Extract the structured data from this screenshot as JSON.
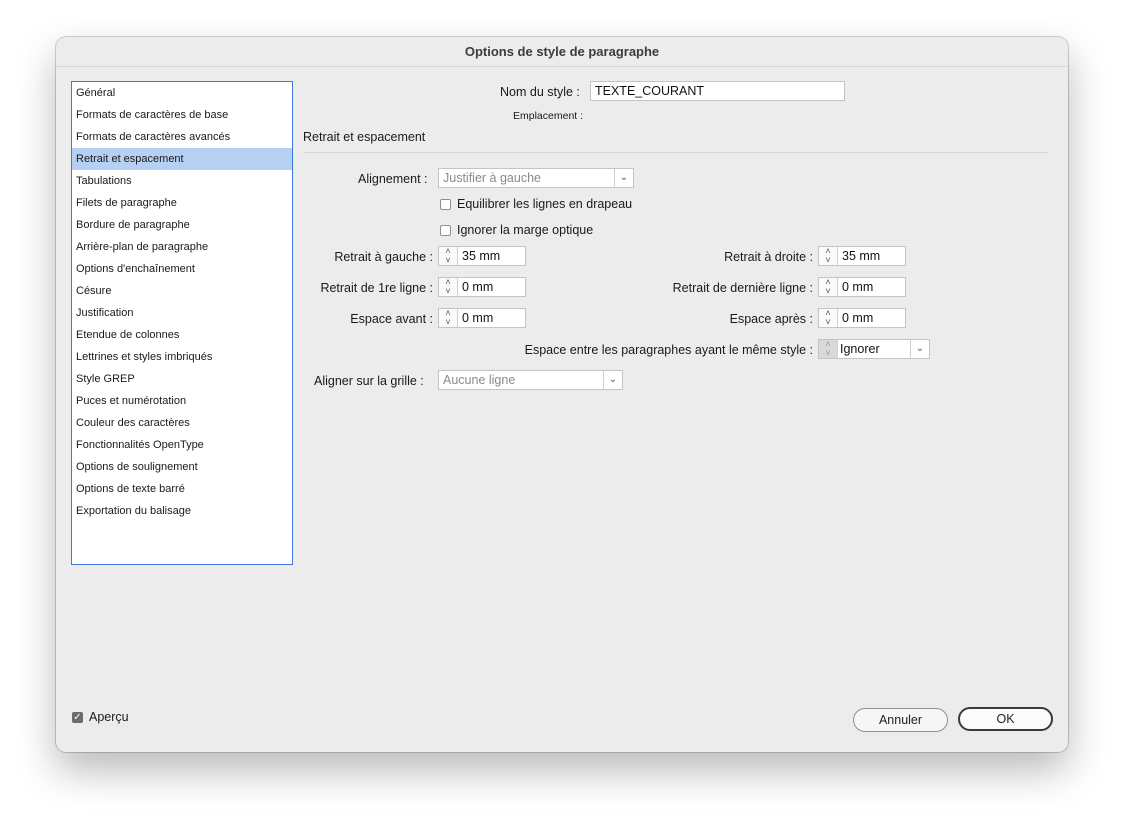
{
  "window": {
    "title": "Options de style de paragraphe"
  },
  "sidebar": {
    "items": [
      {
        "label": "Général",
        "selected": false
      },
      {
        "label": "Formats de caractères de base",
        "selected": false
      },
      {
        "label": "Formats de caractères avancés",
        "selected": false
      },
      {
        "label": "Retrait et espacement",
        "selected": true
      },
      {
        "label": "Tabulations",
        "selected": false
      },
      {
        "label": "Filets de paragraphe",
        "selected": false
      },
      {
        "label": "Bordure de paragraphe",
        "selected": false
      },
      {
        "label": "Arrière-plan de paragraphe",
        "selected": false
      },
      {
        "label": "Options d'enchaînement",
        "selected": false
      },
      {
        "label": "Césure",
        "selected": false
      },
      {
        "label": "Justification",
        "selected": false
      },
      {
        "label": "Etendue de colonnes",
        "selected": false
      },
      {
        "label": "Lettrines et styles imbriqués",
        "selected": false
      },
      {
        "label": "Style GREP",
        "selected": false
      },
      {
        "label": "Puces et numérotation",
        "selected": false
      },
      {
        "label": "Couleur des caractères",
        "selected": false
      },
      {
        "label": "Fonctionnalités OpenType",
        "selected": false
      },
      {
        "label": "Options de soulignement",
        "selected": false
      },
      {
        "label": "Options de texte barré",
        "selected": false
      },
      {
        "label": "Exportation du balisage",
        "selected": false
      }
    ]
  },
  "header": {
    "style_name_label": "Nom du style :",
    "style_name_value": "TEXTE_COURANT",
    "location_label": "Emplacement :"
  },
  "section": {
    "title": "Retrait et espacement",
    "alignment_label": "Alignement :",
    "alignment_value": "Justifier à gauche",
    "balance_label": "Equilibrer les lignes en drapeau",
    "balance_checked": false,
    "optical_label": "Ignorer la marge optique",
    "optical_checked": false,
    "left_indent_label": "Retrait à gauche :",
    "left_indent_value": "35 mm",
    "right_indent_label": "Retrait à droite :",
    "right_indent_value": "35 mm",
    "first_line_label": "Retrait de 1re ligne :",
    "first_line_value": "0 mm",
    "last_line_label": "Retrait de dernière ligne :",
    "last_line_value": "0 mm",
    "space_before_label": "Espace avant :",
    "space_before_value": "0 mm",
    "space_after_label": "Espace après :",
    "space_after_value": "0 mm",
    "same_style_label": "Espace entre les paragraphes ayant le même style :",
    "same_style_value": "Ignorer",
    "grid_label": "Aligner sur la grille :",
    "grid_value": "Aucune ligne"
  },
  "footer": {
    "preview_label": "Aperçu",
    "preview_checked": true,
    "cancel_label": "Annuler",
    "ok_label": "OK"
  },
  "colors": {
    "selection": "#b5d0f2",
    "sidebar_border": "#3f7bd6",
    "dialog_bg": "#ececec"
  }
}
